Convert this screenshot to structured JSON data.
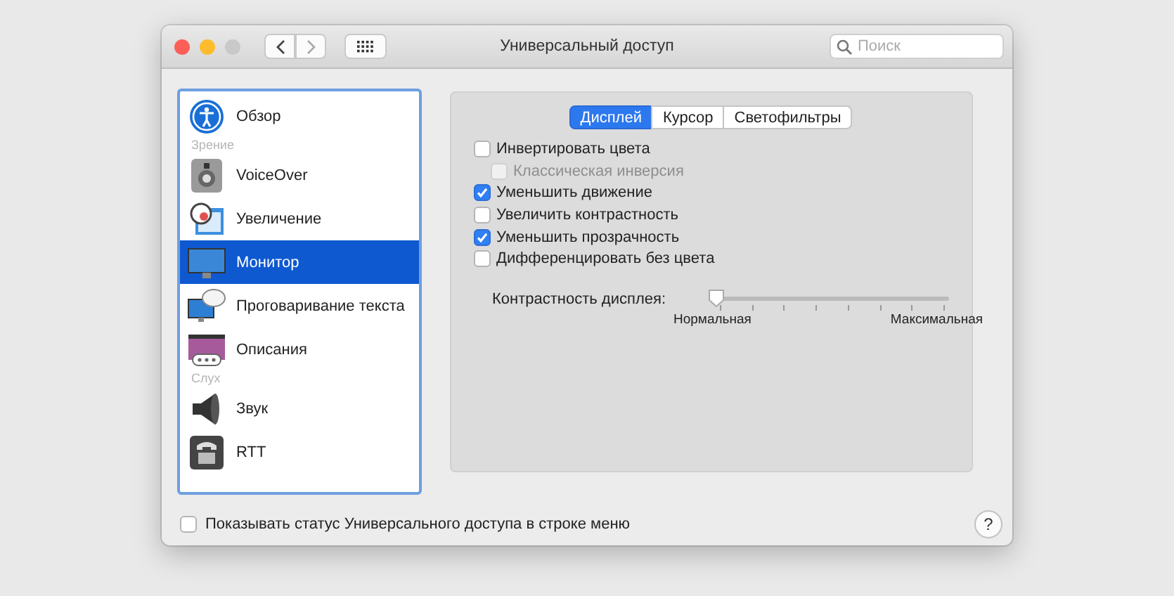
{
  "window": {
    "title": "Универсальный доступ",
    "search": {
      "placeholder": "Поиск"
    }
  },
  "sidebar": {
    "items": [
      {
        "kind": "item",
        "label": "Обзор",
        "selected": false
      },
      {
        "kind": "header",
        "label": "Зрение"
      },
      {
        "kind": "item",
        "label": "VoiceOver",
        "selected": false
      },
      {
        "kind": "item",
        "label": "Увеличение",
        "selected": false
      },
      {
        "kind": "item",
        "label": "Монитор",
        "selected": true
      },
      {
        "kind": "item",
        "label": "Проговаривание текста",
        "selected": false
      },
      {
        "kind": "item",
        "label": "Описания",
        "selected": false
      },
      {
        "kind": "header",
        "label": "Слух"
      },
      {
        "kind": "item",
        "label": "Звук",
        "selected": false
      },
      {
        "kind": "item",
        "label": "RTT",
        "selected": false
      }
    ]
  },
  "tabs": [
    {
      "label": "Дисплей",
      "selected": true
    },
    {
      "label": "Курсор",
      "selected": false
    },
    {
      "label": "Светофильтры",
      "selected": false
    }
  ],
  "options": [
    {
      "label": "Инвертировать цвета",
      "checked": false,
      "disabled": false,
      "children": [
        {
          "label": "Классическая инверсия",
          "checked": false,
          "disabled": true
        }
      ]
    },
    {
      "label": "Уменьшить движение",
      "checked": true,
      "disabled": false
    },
    {
      "label": "Увеличить контрастность",
      "checked": false,
      "disabled": false
    },
    {
      "label": "Уменьшить прозрачность",
      "checked": true,
      "disabled": false
    },
    {
      "label": "Дифференцировать без цвета",
      "checked": false,
      "disabled": false
    }
  ],
  "slider": {
    "label": "Контрастность дисплея:",
    "level": 0,
    "min_label": "Нормальная",
    "max_label": "Максимальная"
  },
  "footer": {
    "label": "Показывать статус Универсального доступа в строке меню",
    "checked": false,
    "help": "?"
  }
}
